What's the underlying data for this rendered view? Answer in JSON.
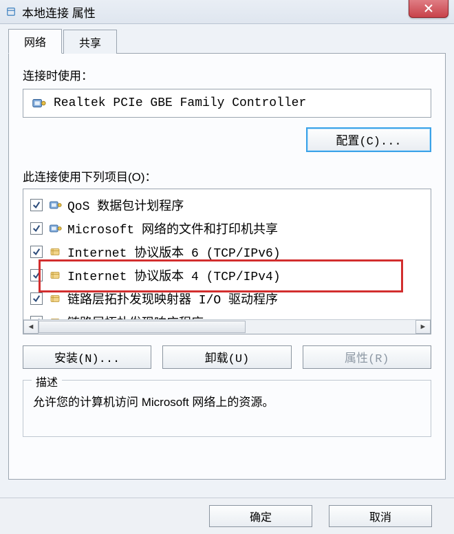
{
  "title": "本地连接 属性",
  "tabs": {
    "network": "网络",
    "share": "共享"
  },
  "connect_label": "连接时使用：",
  "adapter": "Realtek PCIe GBE Family Controller",
  "configure_btn": "配置(C)...",
  "items_label": "此连接使用下列项目(O)：",
  "items": [
    {
      "checked": true,
      "icon": "nic",
      "text": "QoS 数据包计划程序"
    },
    {
      "checked": true,
      "icon": "nic",
      "text": "Microsoft 网络的文件和打印机共享"
    },
    {
      "checked": true,
      "icon": "proto",
      "text": "Internet 协议版本 6 (TCP/IPv6)"
    },
    {
      "checked": true,
      "icon": "proto",
      "text": "Internet 协议版本 4 (TCP/IPv4)"
    },
    {
      "checked": true,
      "icon": "proto",
      "text": "链路层拓扑发现映射器 I/O 驱动程序"
    },
    {
      "checked": true,
      "icon": "proto",
      "text": "链路层拓扑发现响应程序"
    }
  ],
  "highlight_index": 3,
  "install_btn": "安装(N)...",
  "uninstall_btn": "卸载(U)",
  "properties_btn": "属性(R)",
  "desc_legend": "描述",
  "desc_text": "允许您的计算机访问 Microsoft 网络上的资源。",
  "ok_btn": "确定",
  "cancel_btn": "取消"
}
